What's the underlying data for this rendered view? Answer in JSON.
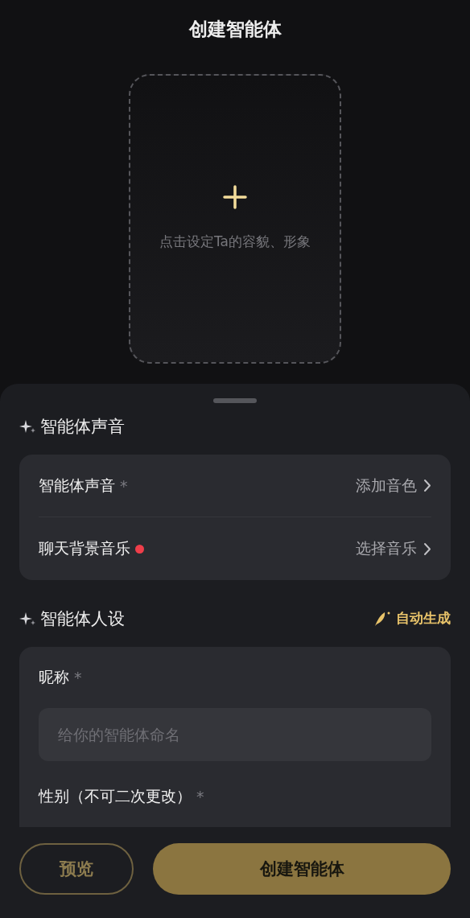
{
  "header": {
    "title": "创建智能体"
  },
  "avatar_upload": {
    "hint": "点击设定Ta的容貌、形象"
  },
  "voice_section": {
    "title": "智能体声音",
    "rows": [
      {
        "label": "智能体声音",
        "required_mark": "*",
        "new_dot": false,
        "value": "添加音色"
      },
      {
        "label": "聊天背景音乐",
        "new_dot": true,
        "value": "选择音乐"
      }
    ]
  },
  "persona_section": {
    "title": "智能体人设",
    "action": "自动生成",
    "fields": [
      {
        "label": "昵称",
        "required_mark": "*",
        "placeholder": "给你的智能体命名"
      },
      {
        "label": "性别（不可二次更改）",
        "required_mark": "*"
      }
    ]
  },
  "footer": {
    "preview_button": "预览",
    "create_button": "创建智能体"
  }
}
